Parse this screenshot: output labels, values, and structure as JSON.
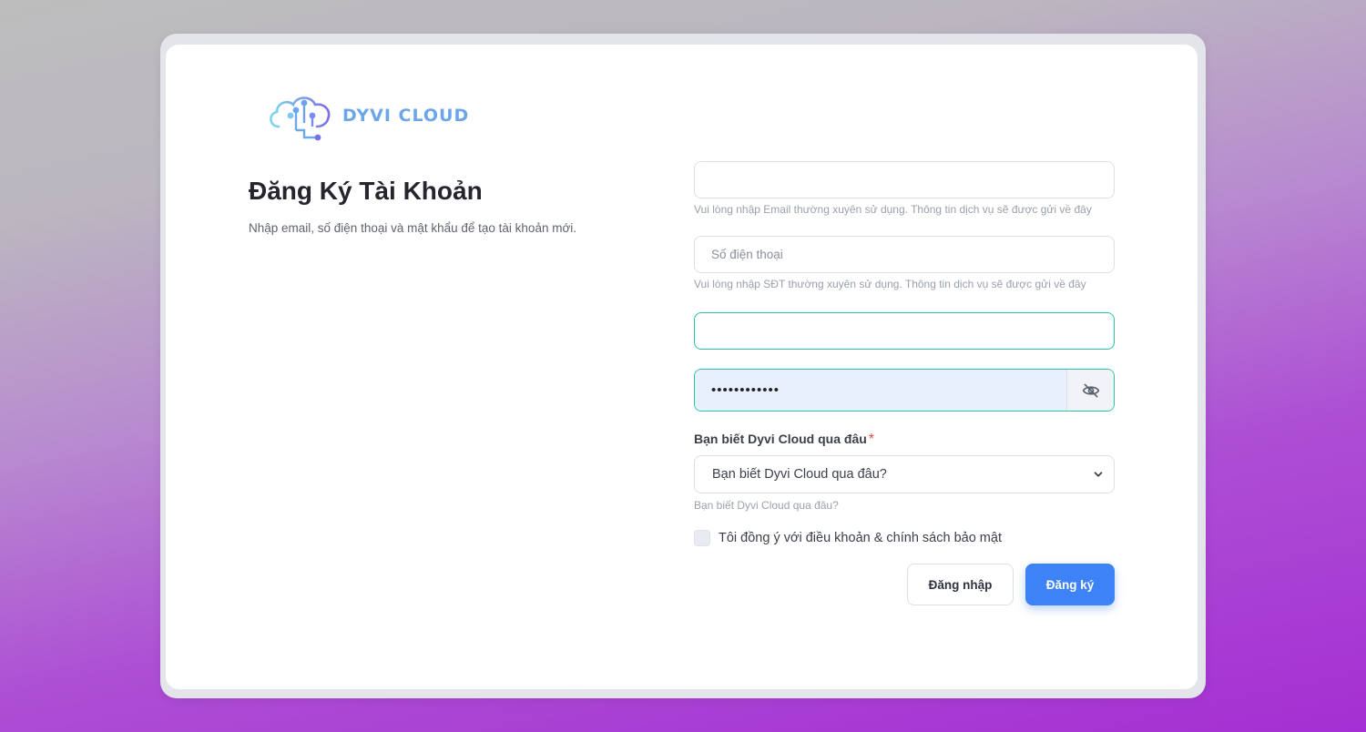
{
  "brand": {
    "name": "DYVI CLOUD",
    "logo_icon": "cloud-circuit-icon"
  },
  "header": {
    "title": "Đăng Ký Tài Khoản",
    "subtitle": "Nhập email, số điện thoại và mật khẩu để tạo tài khoản mới."
  },
  "form": {
    "email": {
      "value": "",
      "placeholder": "",
      "hint": "Vui lòng nhập Email thường xuyên sử dụng. Thông tin dịch vụ sẽ được gửi về đây"
    },
    "phone": {
      "value": "",
      "placeholder": "Số điện thoại",
      "hint": "Vui lòng nhập SĐT thường xuyên sử dụng. Thông tin dịch vụ sẽ được gửi về đây"
    },
    "third_field": {
      "value": "",
      "placeholder": ""
    },
    "password": {
      "value": "••••••••••••",
      "toggle_icon": "eye-slash-icon"
    },
    "source": {
      "label": "Bạn biết Dyvi Cloud qua đâu",
      "required_mark": "*",
      "selected": "Bạn biết Dyvi Cloud qua đâu?",
      "hint": "Bạn biết Dyvi Cloud qua đâu?"
    },
    "terms": {
      "label": "Tôi đồng ý với điều khoản & chính sách bảo mật",
      "checked": false
    },
    "buttons": {
      "login": "Đăng nhập",
      "register": "Đăng ký"
    }
  },
  "colors": {
    "accent": "#3d82f7",
    "focus_border": "#28c4a4",
    "autofill_bg": "#e8f0fe",
    "logo_text": "#6da6e8"
  }
}
